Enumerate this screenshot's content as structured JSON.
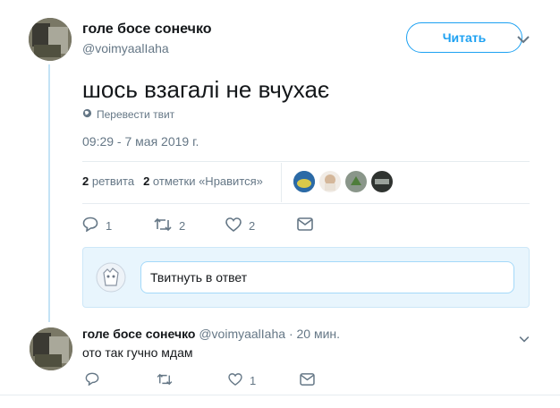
{
  "tweet": {
    "author_name": "голе босе сонечко",
    "author_handle": "@voimyaalIaha",
    "follow_label": "Читать",
    "text": "шось взагалі не вчухає",
    "translate_label": "Перевести твит",
    "timestamp": "09:29 - 7 мая 2019 г.",
    "retweets_count": "2",
    "retweets_label": "ретвита",
    "likes_count": "2",
    "likes_label": "отметки «Нравится»",
    "liker_avatars": [
      "liker-1",
      "liker-2",
      "liker-3",
      "liker-4"
    ],
    "actions": {
      "reply_count": "1",
      "retweet_count": "2",
      "like_count": "2"
    }
  },
  "composer": {
    "placeholder": "Твитнуть в ответ"
  },
  "reply": {
    "author_name": "голе босе сонечко",
    "author_handle": "@voimyaalIaha",
    "time": "· 20 мин.",
    "text": "ото так гучно мдам",
    "actions": {
      "like_count": "1"
    }
  },
  "colors": {
    "accent": "#1da1f2",
    "muted": "#657786",
    "thread_line": "#c4e3f6"
  }
}
